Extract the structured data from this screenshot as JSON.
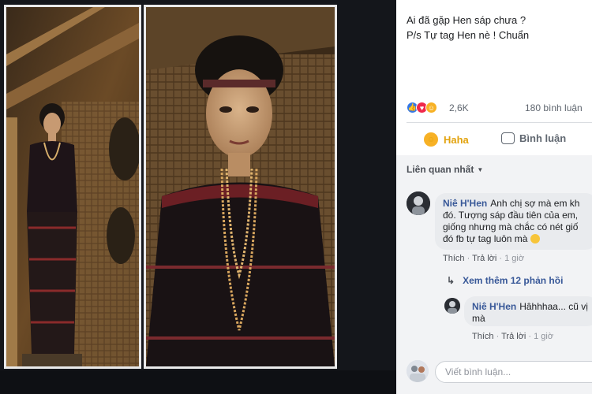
{
  "post": {
    "text_line1": "Ai đã gặp Hen sáp chưa ?",
    "text_line2": "P/s Tự tag Hen nè ! Chuẩn"
  },
  "reactions": {
    "icons": [
      "like-icon",
      "love-icon",
      "haha-icon"
    ],
    "count": "2,6K",
    "comments": "180 bình luận"
  },
  "actions": {
    "haha": "Haha",
    "comment": "Bình luận"
  },
  "sort_label": "Liên quan nhất",
  "comments": [
    {
      "author": "Niê H'Hen",
      "text": "Anh chị sợ mà em kh đó. Tượng sáp đầu tiên của em, giống nhưng mà chắc có nét giố đó fb tự tag luôn mà",
      "like": "Thích",
      "reply": "Trả lời",
      "time": "1 giờ"
    }
  ],
  "see_more_replies": "Xem thêm 12 phản hồi",
  "reply": {
    "author": "Niê H'Hen",
    "text": "Hâhhhaa... cũ vị mà",
    "like": "Thích",
    "reply": "Trả lời",
    "time": "1 giờ"
  },
  "composer_placeholder": "Viết bình luận...",
  "colors": {
    "fb_blue": "#385898",
    "haha_yellow": "#f7b125",
    "love_red": "#f0284a",
    "like_blue": "#3578e5"
  }
}
